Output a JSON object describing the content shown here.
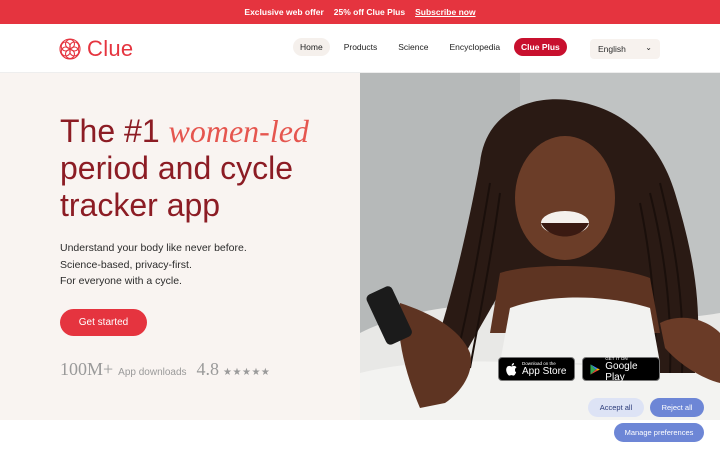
{
  "promo": {
    "offer": "Exclusive web offer",
    "discount": "25% off Clue Plus",
    "subscribe": "Subscribe now"
  },
  "header": {
    "logo_text": "Clue",
    "nav": [
      "Home",
      "Products",
      "Science",
      "Encyclopedia",
      "Clue Plus"
    ],
    "language": "English"
  },
  "hero": {
    "headline_prefix": "The #1 ",
    "headline_emphasis": "women-led",
    "headline_line2": "period and cycle",
    "headline_line3": "tracker app",
    "desc_line1": "Understand your body like never before.",
    "desc_line2": "Science-based, privacy-first.",
    "desc_line3": "For everyone with a cycle.",
    "cta": "Get started",
    "downloads_value": "100M+",
    "downloads_label": "App downloads",
    "rating_value": "4.8",
    "rating_stars": "★★★★★"
  },
  "badges": {
    "appstore_small": "Download on the",
    "appstore_big": "App Store",
    "google_small": "GET IT ON",
    "google_big": "Google Play"
  },
  "cookies": {
    "accept": "Accept all",
    "reject": "Reject all",
    "manage": "Manage preferences"
  },
  "colors": {
    "brand_red": "#e5343f",
    "headline_red": "#8c1c24",
    "cookie_blue": "#6d86d6"
  },
  "icons": [
    "clue-flower-logo-icon",
    "chevron-down-icon",
    "apple-icon",
    "google-play-icon",
    "star-icon"
  ]
}
